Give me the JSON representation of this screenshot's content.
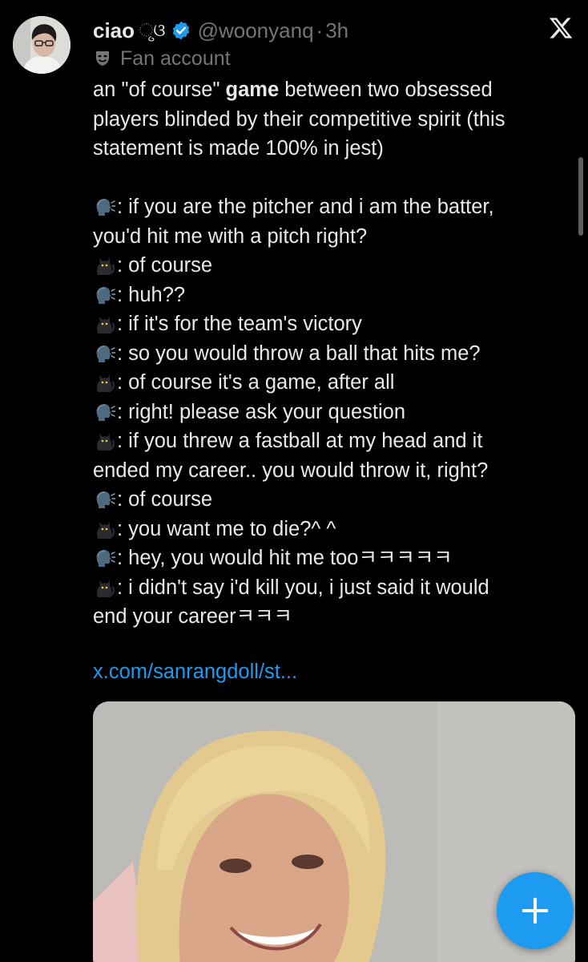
{
  "tweet": {
    "display_name": "ciao",
    "name_decoration": "ୃଓ",
    "handle": "@woonyanq",
    "separator": "·",
    "time": "3h",
    "label": "Fan account",
    "link": "x.com/sanrangdoll/st..."
  },
  "body": {
    "intro_lines": [
      {
        "pre": "an \"of course\" ",
        "bold": "game",
        "post": " between two obsessed"
      },
      {
        "text": "players blinded by their competitive spirit (this"
      },
      {
        "text": "statement is made 100% in jest)"
      }
    ],
    "dialogue_lines": [
      {
        "speaker": "speaking-head",
        "text": ": if you are the pitcher and i am the batter,"
      },
      {
        "speaker": "",
        "text": "you'd hit me with a pitch right?"
      },
      {
        "speaker": "black-cat",
        "text": ": of course"
      },
      {
        "speaker": "speaking-head",
        "text": ": huh??"
      },
      {
        "speaker": "black-cat",
        "text": ": if it's for the team's victory"
      },
      {
        "speaker": "speaking-head",
        "text": ": so you would throw a ball that hits me?"
      },
      {
        "speaker": "black-cat",
        "text": ": of course it's a game, after all"
      },
      {
        "speaker": "speaking-head",
        "text": ": right! please ask your question"
      },
      {
        "speaker": "black-cat",
        "text": ": if you threw a fastball at my head and it"
      },
      {
        "speaker": "",
        "text": "ended my career.. you would throw it, right?"
      },
      {
        "speaker": "speaking-head",
        "text": ": of course"
      },
      {
        "speaker": "black-cat",
        "text": ": you want me to die?^ ^"
      },
      {
        "speaker": "speaking-head",
        "text": ": hey, you would hit me tooㅋㅋㅋㅋㅋ"
      },
      {
        "speaker": "black-cat",
        "text": ": i didn't say i'd kill you, i just said it would"
      },
      {
        "speaker": "",
        "text": "end your careerㅋㅋㅋ"
      }
    ]
  },
  "icons": {
    "verified": "verified-badge-icon",
    "label": "theater-mask-icon",
    "brand": "x-logo-icon",
    "fab": "plus-icon"
  },
  "colors": {
    "background": "#000000",
    "text": "#e7e9ea",
    "secondary": "#71767b",
    "accent": "#1d9bf0"
  }
}
